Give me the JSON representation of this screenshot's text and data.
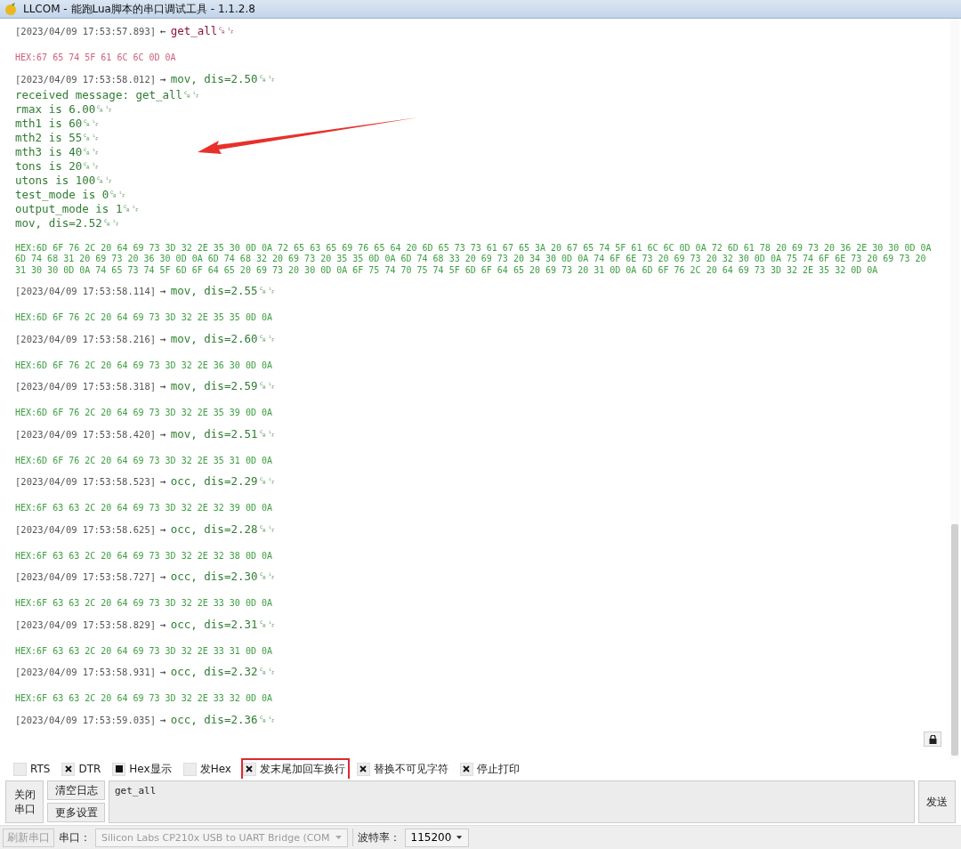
{
  "window": {
    "title": "LLCOM - 能跑Lua脚本的串口调试工具 - 1.1.2.8"
  },
  "log": [
    {
      "kind": "sent",
      "timestamp": "[2023/04/09 17:53:57.893]",
      "arrow": "←",
      "lines": [
        "get_all␍␊"
      ],
      "hex": "HEX:67 65 74 5F 61 6C 6C 0D 0A"
    },
    {
      "kind": "received",
      "timestamp": "[2023/04/09 17:53:58.012]",
      "arrow": "→",
      "lines": [
        "mov, dis=2.50␍␊",
        "received message: get_all␍␊",
        "rmax is 6.00␍␊",
        "mth1 is 60␍␊",
        "mth2 is 55␍␊",
        "mth3 is 40␍␊",
        "tons is 20␍␊",
        "utons is 100␍␊",
        "test_mode is 0␍␊",
        "output_mode is 1␍␊",
        "mov, dis=2.52␍␊"
      ],
      "hex": "HEX:6D 6F 76 2C 20 64 69 73 3D 32 2E 35 30 0D 0A 72 65 63 65 69 76 65 64 20 6D 65 73 73 61 67 65 3A 20 67 65 74 5F 61 6C 6C 0D 0A 72 6D 61 78 20 69 73 20 36 2E 30 30 0D 0A 6D 74 68 31 20 69 73 20 36 30 0D 0A 6D 74 68 32 20 69 73 20 35 35 0D 0A 6D 74 68 33 20 69 73 20 34 30 0D 0A 74 6F 6E 73 20 69 73 20 32 30 0D 0A 75 74 6F 6E 73 20 69 73 20 31 30 30 0D 0A 74 65 73 74 5F 6D 6F 64 65 20 69 73 20 30 0D 0A 6F 75 74 70 75 74 5F 6D 6F 64 65 20 69 73 20 31 0D 0A 6D 6F 76 2C 20 64 69 73 3D 32 2E 35 32 0D 0A"
    },
    {
      "kind": "received",
      "timestamp": "[2023/04/09 17:53:58.114]",
      "arrow": "→",
      "lines": [
        "mov, dis=2.55␍␊"
      ],
      "hex": "HEX:6D 6F 76 2C 20 64 69 73 3D 32 2E 35 35 0D 0A"
    },
    {
      "kind": "received",
      "timestamp": "[2023/04/09 17:53:58.216]",
      "arrow": "→",
      "lines": [
        "mov, dis=2.60␍␊"
      ],
      "hex": "HEX:6D 6F 76 2C 20 64 69 73 3D 32 2E 36 30 0D 0A"
    },
    {
      "kind": "received",
      "timestamp": "[2023/04/09 17:53:58.318]",
      "arrow": "→",
      "lines": [
        "mov, dis=2.59␍␊"
      ],
      "hex": "HEX:6D 6F 76 2C 20 64 69 73 3D 32 2E 35 39 0D 0A"
    },
    {
      "kind": "received",
      "timestamp": "[2023/04/09 17:53:58.420]",
      "arrow": "→",
      "lines": [
        "mov, dis=2.51␍␊"
      ],
      "hex": "HEX:6D 6F 76 2C 20 64 69 73 3D 32 2E 35 31 0D 0A"
    },
    {
      "kind": "received",
      "timestamp": "[2023/04/09 17:53:58.523]",
      "arrow": "→",
      "lines": [
        "occ, dis=2.29␍␊"
      ],
      "hex": "HEX:6F 63 63 2C 20 64 69 73 3D 32 2E 32 39 0D 0A"
    },
    {
      "kind": "received",
      "timestamp": "[2023/04/09 17:53:58.625]",
      "arrow": "→",
      "lines": [
        "occ, dis=2.28␍␊"
      ],
      "hex": "HEX:6F 63 63 2C 20 64 69 73 3D 32 2E 32 38 0D 0A"
    },
    {
      "kind": "received",
      "timestamp": "[2023/04/09 17:53:58.727]",
      "arrow": "→",
      "lines": [
        "occ, dis=2.30␍␊"
      ],
      "hex": "HEX:6F 63 63 2C 20 64 69 73 3D 32 2E 33 30 0D 0A"
    },
    {
      "kind": "received",
      "timestamp": "[2023/04/09 17:53:58.829]",
      "arrow": "→",
      "lines": [
        "occ, dis=2.31␍␊"
      ],
      "hex": "HEX:6F 63 63 2C 20 64 69 73 3D 32 2E 33 31 0D 0A"
    },
    {
      "kind": "received",
      "timestamp": "[2023/04/09 17:53:58.931]",
      "arrow": "→",
      "lines": [
        "occ, dis=2.32␍␊"
      ],
      "hex": "HEX:6F 63 63 2C 20 64 69 73 3D 32 2E 33 32 0D 0A"
    },
    {
      "kind": "received",
      "timestamp": "[2023/04/09 17:53:59.035]",
      "arrow": "→",
      "lines": [
        "occ, dis=2.36␍␊"
      ]
    }
  ],
  "annotations": [
    {
      "kind": "arrow"
    }
  ],
  "options": [
    {
      "label": "RTS",
      "checked": false,
      "indeterminate": false,
      "highlighted": false
    },
    {
      "label": "DTR",
      "checked": true,
      "indeterminate": false,
      "highlighted": false
    },
    {
      "label": "Hex显示",
      "checked": false,
      "indeterminate": true,
      "highlighted": false
    },
    {
      "label": "发Hex",
      "checked": false,
      "indeterminate": false,
      "highlighted": false
    },
    {
      "label": "发末尾加回车换行",
      "checked": true,
      "indeterminate": false,
      "highlighted": true
    },
    {
      "label": "替换不可见字符",
      "checked": true,
      "indeterminate": false,
      "highlighted": false
    },
    {
      "label": "停止打印",
      "checked": true,
      "indeterminate": false,
      "highlighted": false
    }
  ],
  "send_panel": {
    "close_button": "关闭串口",
    "clear_button": "清空日志",
    "more_button": "更多设置",
    "input": "get_all",
    "send_button": "发送"
  },
  "status_bar": {
    "refresh_button": {
      "label": "刷新串口",
      "disabled": true
    },
    "port_label": "串口：",
    "port": {
      "value": "Silicon Labs CP210x USB to UART Bridge (COM",
      "disabled": true
    },
    "baud_label": "波特率：",
    "baud": {
      "value": "115200",
      "disabled": false
    }
  }
}
